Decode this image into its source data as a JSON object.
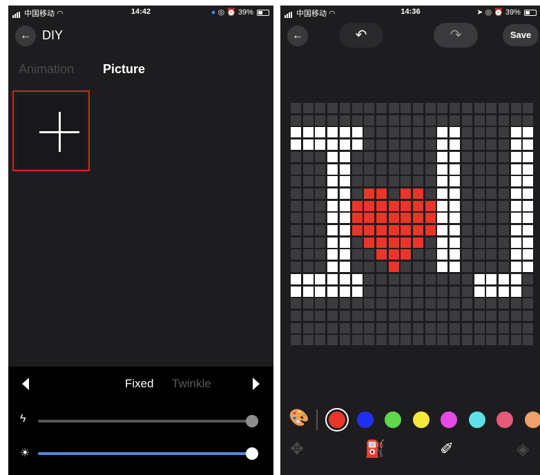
{
  "left": {
    "status": {
      "carrier": "中国移动",
      "time": "14:42",
      "battery": "39%"
    },
    "header": {
      "back_icon": "arrow-left-icon",
      "title": "DIY"
    },
    "tabs": [
      {
        "label": "Animation"
      },
      {
        "label": "Picture"
      }
    ],
    "add_tile": {
      "icon": "plus-icon"
    },
    "mode": {
      "left_icon": "triangle-left-icon",
      "right_icon": "triangle-right-icon",
      "fixed": "Fixed",
      "twinkle": "Twinkle"
    },
    "speed_slider": {
      "icon": "lightning-icon",
      "value": 1.0,
      "color": "#555555"
    },
    "brightness_slider": {
      "icon": "sun-icon",
      "value": 1.0,
      "color": "#4a90e2"
    }
  },
  "right": {
    "status": {
      "carrier": "中国移动",
      "time": "14:36",
      "battery": "39%"
    },
    "toolbar": {
      "back_icon": "arrow-left-icon",
      "undo_icon": "undo-icon",
      "redo_icon": "redo-icon",
      "save_label": "Save"
    },
    "grid": {
      "cols": 20,
      "rows": 20,
      "colors": {
        "off": "#3c3c3e",
        "white": "#ffffff",
        "red": "#e8362a"
      },
      "rows_map": [
        "....................",
        "....................",
        "WWWWWW......WW....WW",
        "WWWWWW......WW....WW",
        "...WW.......WW....WW",
        "...WW.......WW....WW",
        "...WW.......WW....WW",
        "...WW.RR.RR.WW....WW",
        "...WWRRRRRRRWW....WW",
        "...WWRRRRRRRWW....WW",
        "...WWRRRRRRRWW....WW",
        "...WW.RRRRR.WW....WW",
        "...WW..RRR..WW....WW",
        "...WW...R...WW....WW",
        "WWWWWW.........WWWW.",
        "WWWWWW.........WWWW.",
        "....................",
        "....................",
        "....................",
        "...................."
      ]
    },
    "palette": {
      "icon": "palette-icon",
      "colors": [
        "#e8362a",
        "#1f2ff5",
        "#5fd64c",
        "#f5e83c",
        "#e84ae6",
        "#5ee0e6",
        "#e85a7a",
        "#f0a06a"
      ],
      "selected": 0
    },
    "tools": [
      {
        "icon": "move-icon"
      },
      {
        "icon": "fill-bucket-icon"
      },
      {
        "icon": "pen-eraser-icon",
        "active": true
      },
      {
        "icon": "eraser-icon"
      }
    ]
  }
}
